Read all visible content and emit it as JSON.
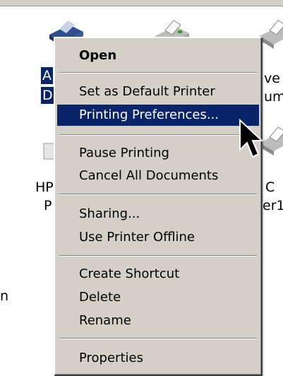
{
  "background_labels": {
    "left_top_1": "A",
    "left_top_2": "D",
    "right_top_1": "ve",
    "right_top_2": "um",
    "left_mid_1": "HP",
    "left_mid_2": "P",
    "right_mid_1": "C",
    "right_mid_2": "er1",
    "left_bottom": "n"
  },
  "menu": {
    "open": "Open",
    "set_default": "Set as Default Printer",
    "printing_prefs": "Printing Preferences...",
    "pause": "Pause Printing",
    "cancel_all": "Cancel All Documents",
    "sharing": "Sharing...",
    "offline": "Use Printer Offline",
    "create_shortcut": "Create Shortcut",
    "delete": "Delete",
    "rename": "Rename",
    "properties": "Properties"
  },
  "colors": {
    "selection": "#0a246a",
    "menu_bg": "#d4d0c8"
  }
}
